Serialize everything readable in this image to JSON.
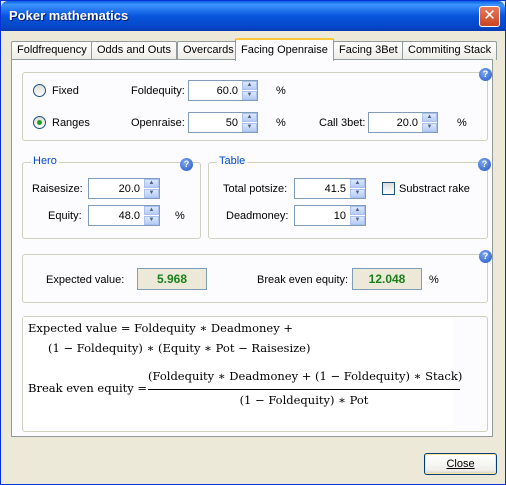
{
  "window": {
    "title": "Poker mathematics",
    "close_glyph": "✕"
  },
  "tabs": [
    {
      "label": "Foldfrequency"
    },
    {
      "label": "Odds and Outs"
    },
    {
      "label": "Overcards"
    },
    {
      "label": "Facing Openraise",
      "active": true
    },
    {
      "label": "Facing 3Bet"
    },
    {
      "label": "Commiting Stack"
    }
  ],
  "mode": {
    "fixed_label": "Fixed",
    "ranges_label": "Ranges",
    "selected": "Ranges",
    "foldequity_label": "Foldequity:",
    "foldequity_value": "60.0",
    "foldequity_unit": "%",
    "openraise_label": "Openraise:",
    "openraise_value": "50",
    "openraise_unit": "%",
    "call3bet_label": "Call 3bet:",
    "call3bet_value": "20.0",
    "call3bet_unit": "%"
  },
  "hero": {
    "legend": "Hero",
    "raisesize_label": "Raisesize:",
    "raisesize_value": "20.0",
    "equity_label": "Equity:",
    "equity_value": "48.0",
    "equity_unit": "%"
  },
  "table": {
    "legend": "Table",
    "potsize_label": "Total potsize:",
    "potsize_value": "41.5",
    "deadmoney_label": "Deadmoney:",
    "deadmoney_value": "10",
    "subtract_rake_label": "Substract rake",
    "subtract_rake_checked": false
  },
  "results": {
    "ev_label": "Expected value:",
    "ev_value": "5.968",
    "be_label": "Break even equity:",
    "be_value": "12.048",
    "be_unit": "%"
  },
  "formulas": {
    "ev_line1": "Expected value = Foldequity ∗ Deadmoney +",
    "ev_line2": "(1 − Foldequity) ∗ (Equity ∗ Pot − Raisesize)",
    "be_lhs": "Break even equity =",
    "be_num": "(Foldequity ∗ Deadmoney + (1 − Foldequity) ∗ Stack)",
    "be_den": "(1 − Foldequity) ∗ Pot"
  },
  "help_glyph": "?",
  "spin_up_glyph": "▲",
  "spin_down_glyph": "▼",
  "close_button_label": "Close",
  "colors": {
    "title_blue": "#0855dd",
    "legend_blue": "#0046d5",
    "result_green": "#1a7f1a",
    "active_tab_accent": "#ffc83c"
  }
}
